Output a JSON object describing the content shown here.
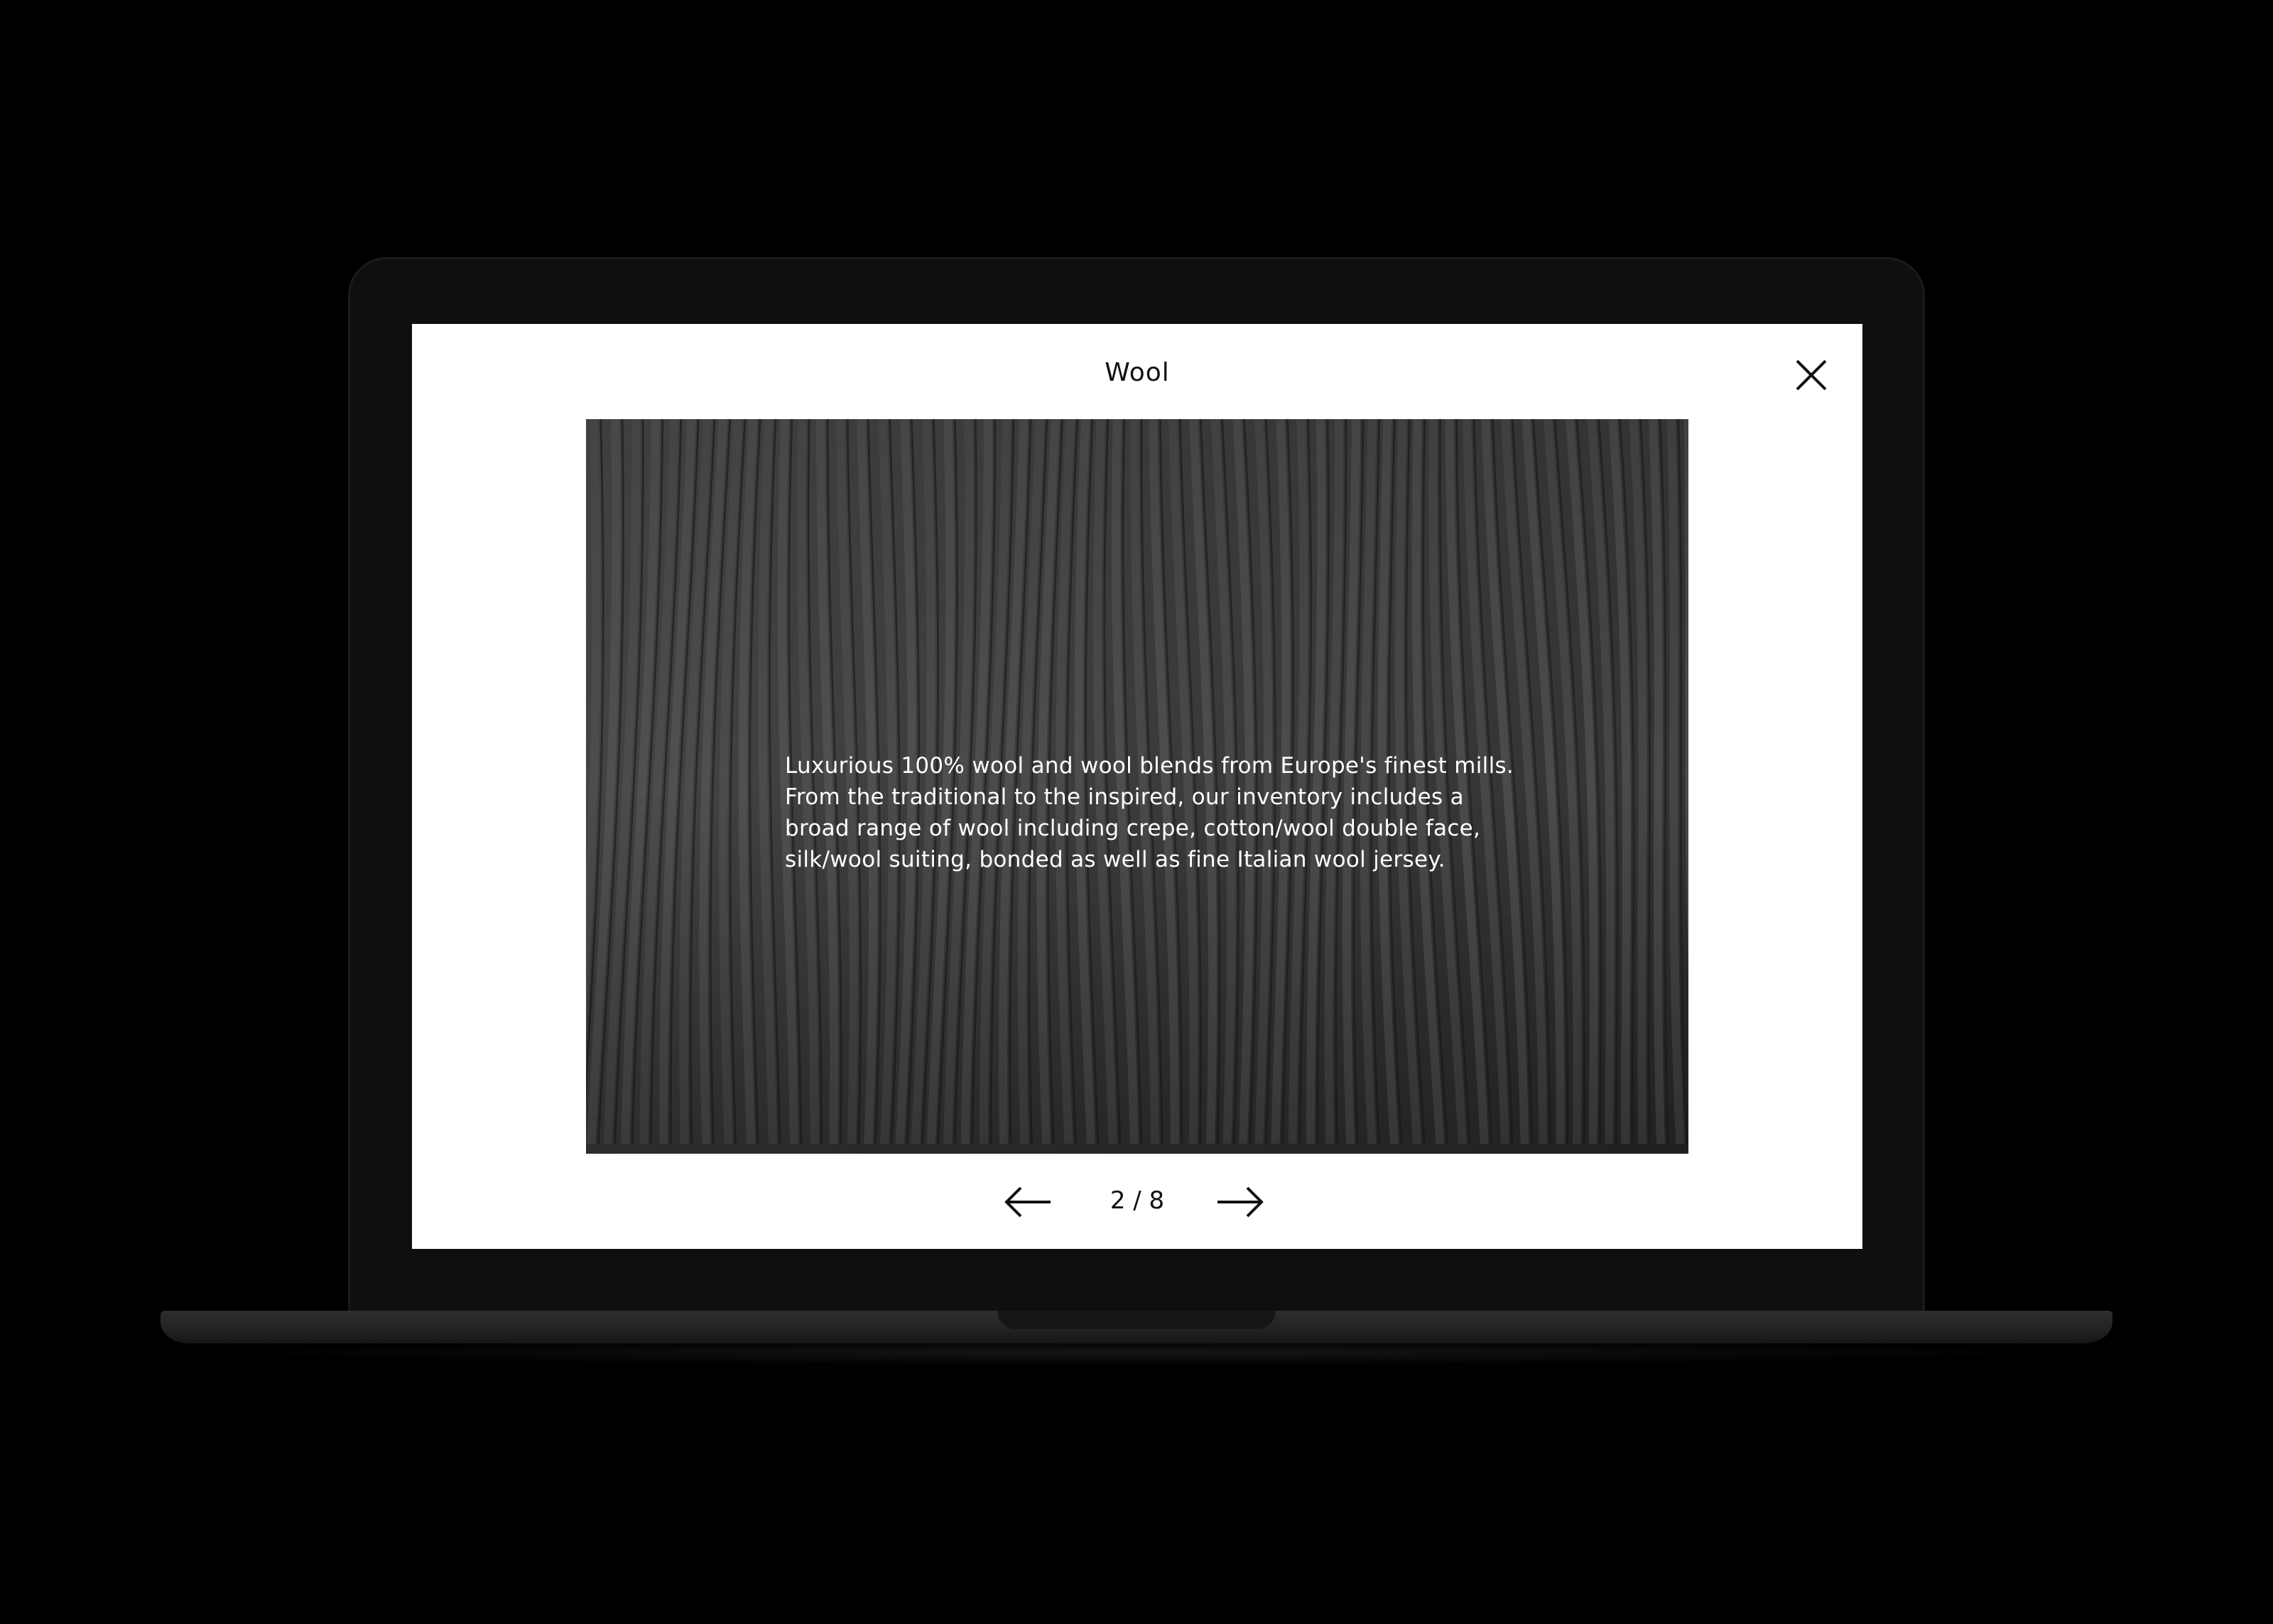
{
  "modal": {
    "title": "Wool",
    "caption_lines": [
      "Luxurious 100% wool and wool blends from Europe's finest mills.",
      "From the traditional to the inspired, our inventory includes a",
      "broad range of wool including crepe, cotton/wool double face,",
      "silk/wool suiting, bonded as well as fine Italian wool jersey."
    ],
    "pager": {
      "current": 2,
      "total": 8,
      "label": "2 / 8"
    }
  },
  "icons": {
    "close": "close-icon",
    "prev": "arrow-left-icon",
    "next": "arrow-right-icon"
  },
  "colors": {
    "background": "#000000",
    "screen": "#ffffff",
    "text": "#111111",
    "photo_tone": "#3a3a3a"
  }
}
